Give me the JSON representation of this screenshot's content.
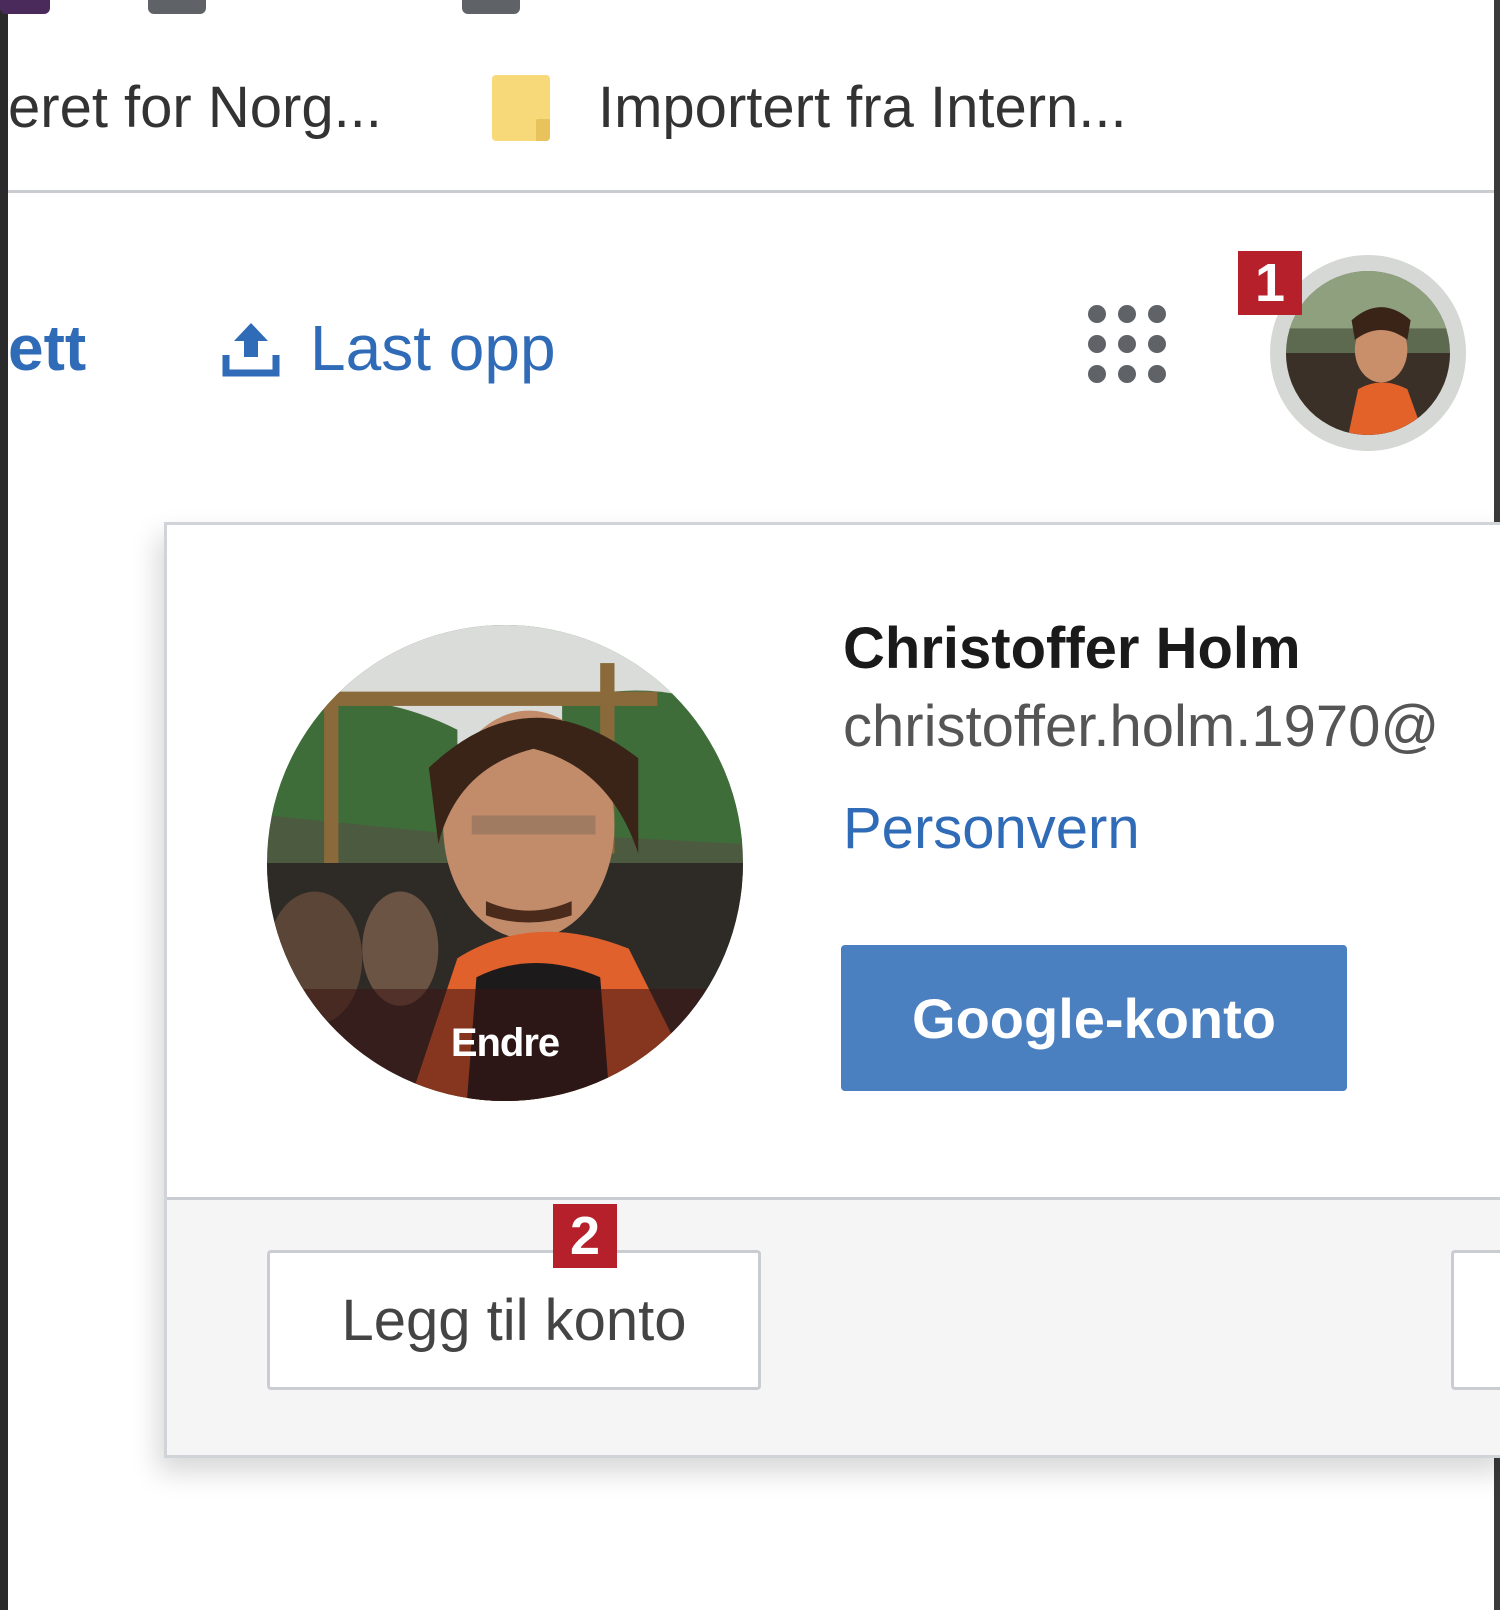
{
  "bookmarks": {
    "items": [
      {
        "label": "eret for Norg..."
      },
      {
        "label": "Importert fra Intern..."
      }
    ]
  },
  "header": {
    "nav_partial_label": "ett",
    "upload_label": "Last opp",
    "apps_icon": "apps-grid-icon",
    "upload_icon": "upload-icon"
  },
  "markers": {
    "one": "1",
    "two": "2"
  },
  "account_popup": {
    "name": "Christoffer Holm",
    "email": "christoffer.holm.1970@",
    "privacy_link": "Personvern",
    "change_photo_label": "Endre",
    "google_account_button": "Google-konto",
    "add_account_button": "Legg til konto"
  },
  "colors": {
    "link_blue": "#2f6bb7",
    "primary_button": "#4a7fc0",
    "marker_red": "#b5202a",
    "folder_yellow": "#f7d97a"
  }
}
